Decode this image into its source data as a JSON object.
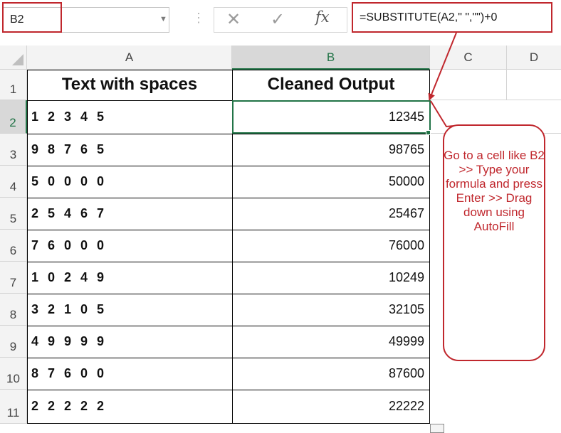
{
  "formula_bar": {
    "name_box": "B2",
    "formula": "=SUBSTITUTE(A2,\" \",\"\")+0",
    "cancel_icon": "✕",
    "enter_icon": "✓",
    "fx_label": "fx",
    "dropdown_icon": "▼",
    "grip_icon": "⋮"
  },
  "columns": [
    "A",
    "B",
    "C",
    "D"
  ],
  "rows": [
    "1",
    "2",
    "3",
    "4",
    "5",
    "6",
    "7",
    "8",
    "9",
    "10",
    "11"
  ],
  "headers": {
    "a": "Text with spaces",
    "b": "Cleaned Output"
  },
  "data": [
    {
      "text": "1 2 3 4 5",
      "value": "12345"
    },
    {
      "text": "9 8 7 6 5",
      "value": "98765"
    },
    {
      "text": "5 0 0 0 0",
      "value": "50000"
    },
    {
      "text": "2 5 4 6 7",
      "value": "25467"
    },
    {
      "text": "7 6 0 0 0",
      "value": "76000"
    },
    {
      "text": "1 0 2 4 9",
      "value": "10249"
    },
    {
      "text": "3 2 1 0 5",
      "value": "32105"
    },
    {
      "text": "4 9 9 9 9",
      "value": "49999"
    },
    {
      "text": "8 7 6 0 0",
      "value": "87600"
    },
    {
      "text": "2 2 2 2 2",
      "value": "22222"
    }
  ],
  "callout": "Go to a cell like B2 >> Type your formula and press Enter >> Drag down using AutoFill",
  "colors": {
    "accent_red": "#c0272d",
    "excel_green": "#217346"
  }
}
